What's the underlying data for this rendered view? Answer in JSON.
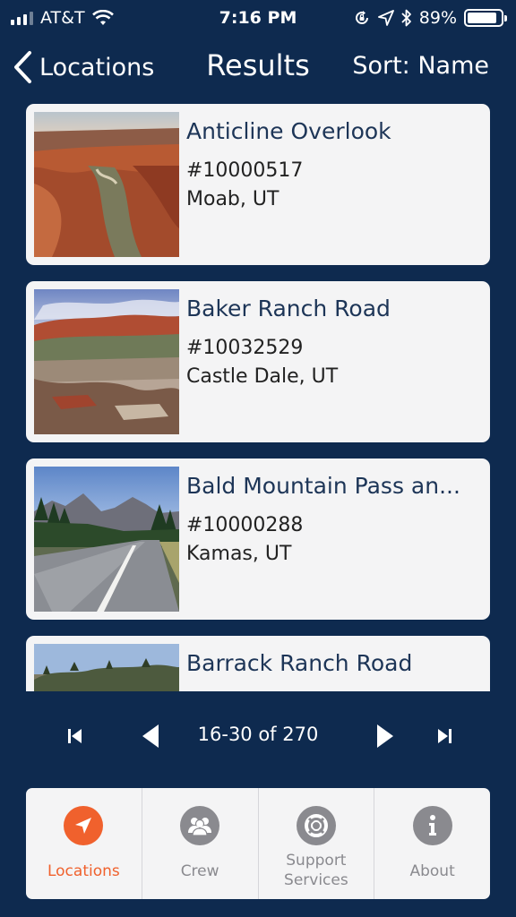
{
  "status": {
    "carrier": "AT&T",
    "time": "7:16 PM",
    "battery": "89%",
    "battery_level": 0.89,
    "icons": [
      "signal-icon",
      "wifi-icon",
      "orientation-lock-icon",
      "location-arrow-icon",
      "bluetooth-icon",
      "battery-icon"
    ]
  },
  "nav": {
    "back_label": "Locations",
    "title": "Results",
    "sort_label": "Sort: Name"
  },
  "results": [
    {
      "name": "Anticline Overlook",
      "id": "#10000517",
      "location": "Moab, UT",
      "image": "red-canyon-photo"
    },
    {
      "name": "Baker Ranch Road",
      "id": "#10032529",
      "location": "Castle Dale, UT",
      "image": "badlands-photo"
    },
    {
      "name": "Bald Mountain Pass an...",
      "id": "#10000288",
      "location": "Kamas, UT",
      "image": "mountain-road-photo"
    },
    {
      "name": "Barrack Ranch Road",
      "id": "",
      "location": "",
      "image": "hillside-photo"
    }
  ],
  "pager": {
    "label": "16-30 of 270",
    "icons": [
      "first-page-icon",
      "previous-page-icon",
      "next-page-icon",
      "last-page-icon"
    ]
  },
  "tabs": [
    {
      "label": "Locations",
      "icon": "location-arrow-icon",
      "active": true
    },
    {
      "label": "Crew",
      "icon": "crew-icon",
      "active": false
    },
    {
      "label": "Support Services",
      "label_line1": "Support",
      "label_line2": "Services",
      "icon": "lifebuoy-icon",
      "active": false
    },
    {
      "label": "About",
      "icon": "info-icon",
      "active": false
    }
  ],
  "colors": {
    "background": "#0e2a4f",
    "card": "#f4f4f5",
    "title_text": "#1d3557",
    "accent": "#f0612d",
    "inactive": "#8a8a8f"
  }
}
